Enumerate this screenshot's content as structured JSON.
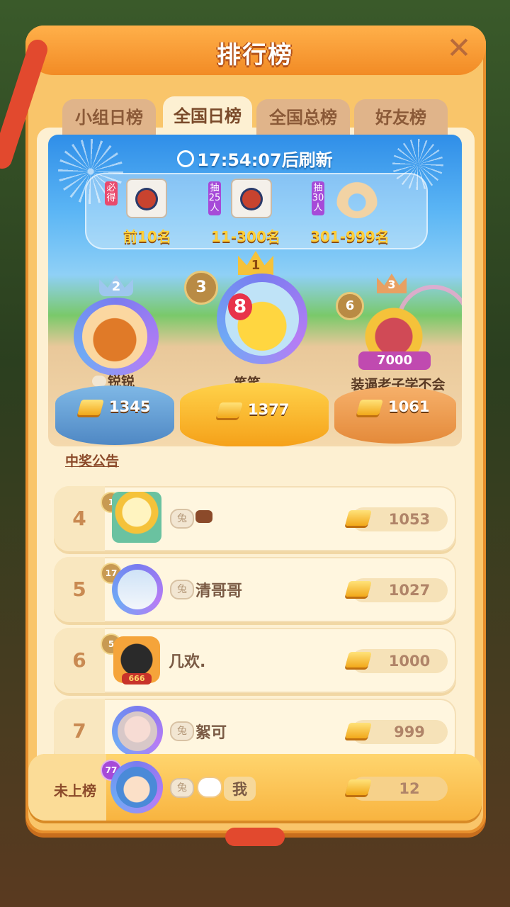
{
  "title": "排行榜",
  "tabs": [
    {
      "label": "小组日榜",
      "active": false
    },
    {
      "label": "全国日榜",
      "active": true
    },
    {
      "label": "全国总榜",
      "active": false
    },
    {
      "label": "好友榜",
      "active": false
    }
  ],
  "refresh_text": "17:54:07后刷新",
  "prizes": [
    {
      "tag": "必得",
      "label": "前10名",
      "tag_color": "#e94a6d"
    },
    {
      "tag": "抽25人",
      "label": "11-300名",
      "tag_color": "#a64ad8"
    },
    {
      "tag": "抽30人",
      "label": "301-999名",
      "tag_color": "#a64ad8"
    }
  ],
  "podium": {
    "first": {
      "crown": "1",
      "badge": "3",
      "name": "笑笑",
      "score": "1377",
      "avatar_badge": "8"
    },
    "second": {
      "crown": "2",
      "name": "锐锐",
      "score": "1345"
    },
    "third": {
      "crown": "3",
      "badge": "6",
      "name": "装逼老子学不会",
      "score": "1061",
      "plate": "7000"
    }
  },
  "announcement": "中奖公告",
  "rows": [
    {
      "rank": "4",
      "level": "1",
      "name": "",
      "score": "1053"
    },
    {
      "rank": "5",
      "level": "17",
      "name": "清哥哥",
      "score": "1027"
    },
    {
      "rank": "6",
      "level": "5",
      "name": "几欢.",
      "score": "1000",
      "plate": "666"
    },
    {
      "rank": "7",
      "level": "",
      "name": "絮可",
      "score": "999"
    }
  ],
  "me": {
    "rank_label": "未上榜",
    "level": "77",
    "name": "我",
    "score": "12"
  },
  "colors": {
    "accent": "#f28b25",
    "panel": "#f9c56a",
    "ribbon": "#e2492e"
  }
}
